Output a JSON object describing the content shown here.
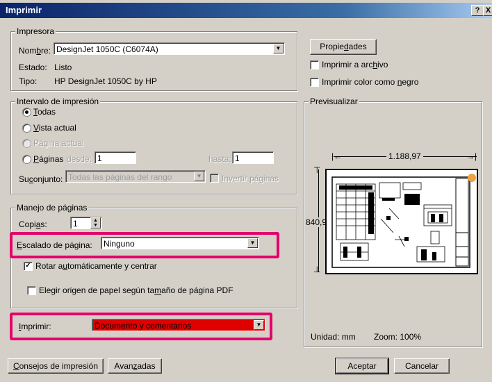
{
  "window": {
    "title": "Imprimir",
    "help_btn": "?",
    "close_btn": "X"
  },
  "printer": {
    "group_title": "Impresora",
    "name_label": "Nombre:",
    "name_value": "DesignJet 1050C (C6074A)",
    "state_label": "Estado:",
    "state_value": "Listo",
    "type_label": "Tipo:",
    "type_value": "HP DesignJet 1050C by HP",
    "properties_btn": "Propiedades",
    "print_to_file": "Imprimir a archivo",
    "print_to_file_checked": false,
    "print_black": "Imprimir color como negro",
    "print_black_checked": false
  },
  "range": {
    "group_title": "Intervalo de impresión",
    "all": "Todas",
    "current_view": "Vista actual",
    "current_page": "Página actual",
    "pages": "Páginas",
    "from_label": "desde:",
    "from_value": "1",
    "to_label": "hasta:",
    "to_value": "1",
    "subset_label": "Suconjunto:",
    "subset_value": "Todas las páginas del rango",
    "reverse": "Invertir páginas",
    "selected": "all"
  },
  "handling": {
    "group_title": "Manejo de páginas",
    "copies_label": "Copias:",
    "copies_value": "1",
    "scaling_label": "Escalado de página:",
    "scaling_value": "Ninguno",
    "autorotate": "Rotar automáticamente y centrar",
    "autorotate_checked": true,
    "paper_source": "Elegir origen de papel según tamaño de página PDF",
    "paper_source_checked": false
  },
  "print_what": {
    "label": "Imprimir:",
    "value": "Documento y comentarios"
  },
  "preview": {
    "group_title": "Previsualizar",
    "width": "1.188,97",
    "height": "840,91",
    "unit": "Unidad: mm",
    "zoom": "Zoom: 100%"
  },
  "buttons": {
    "tips": "Consejos de impresión",
    "advanced": "Avanzadas",
    "ok": "Aceptar",
    "cancel": "Cancelar"
  },
  "colors": {
    "highlight": "#e4006b",
    "print_what_bg": "#e00000",
    "title_bar": "#0a246a"
  }
}
